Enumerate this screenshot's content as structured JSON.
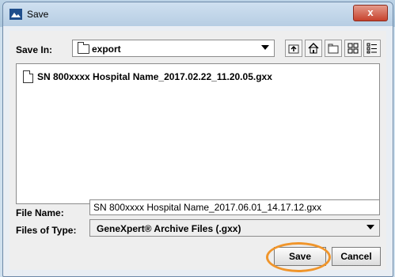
{
  "window": {
    "title": "Save",
    "close_label": "x"
  },
  "save_in": {
    "label": "Save In:",
    "folder": "export"
  },
  "toolbar": {
    "icons": [
      "up-folder-icon",
      "home-icon",
      "new-folder-icon",
      "list-view-icon",
      "details-view-icon"
    ]
  },
  "file_list": {
    "items": [
      {
        "name": "SN 800xxxx Hospital Name_2017.02.22_11.20.05.gxx",
        "icon": "file-icon"
      }
    ]
  },
  "file_name": {
    "label": "File Name:",
    "value": "SN 800xxxx Hospital Name_2017.06.01_14.17.12.gxx"
  },
  "files_of_type": {
    "label": "Files of Type:",
    "value": "GeneXpert® Archive Files (.gxx)"
  },
  "buttons": {
    "save": "Save",
    "cancel": "Cancel"
  },
  "colors": {
    "highlight": "#f0952b",
    "title_bar": "#b6cde3",
    "close": "#c7422d"
  }
}
